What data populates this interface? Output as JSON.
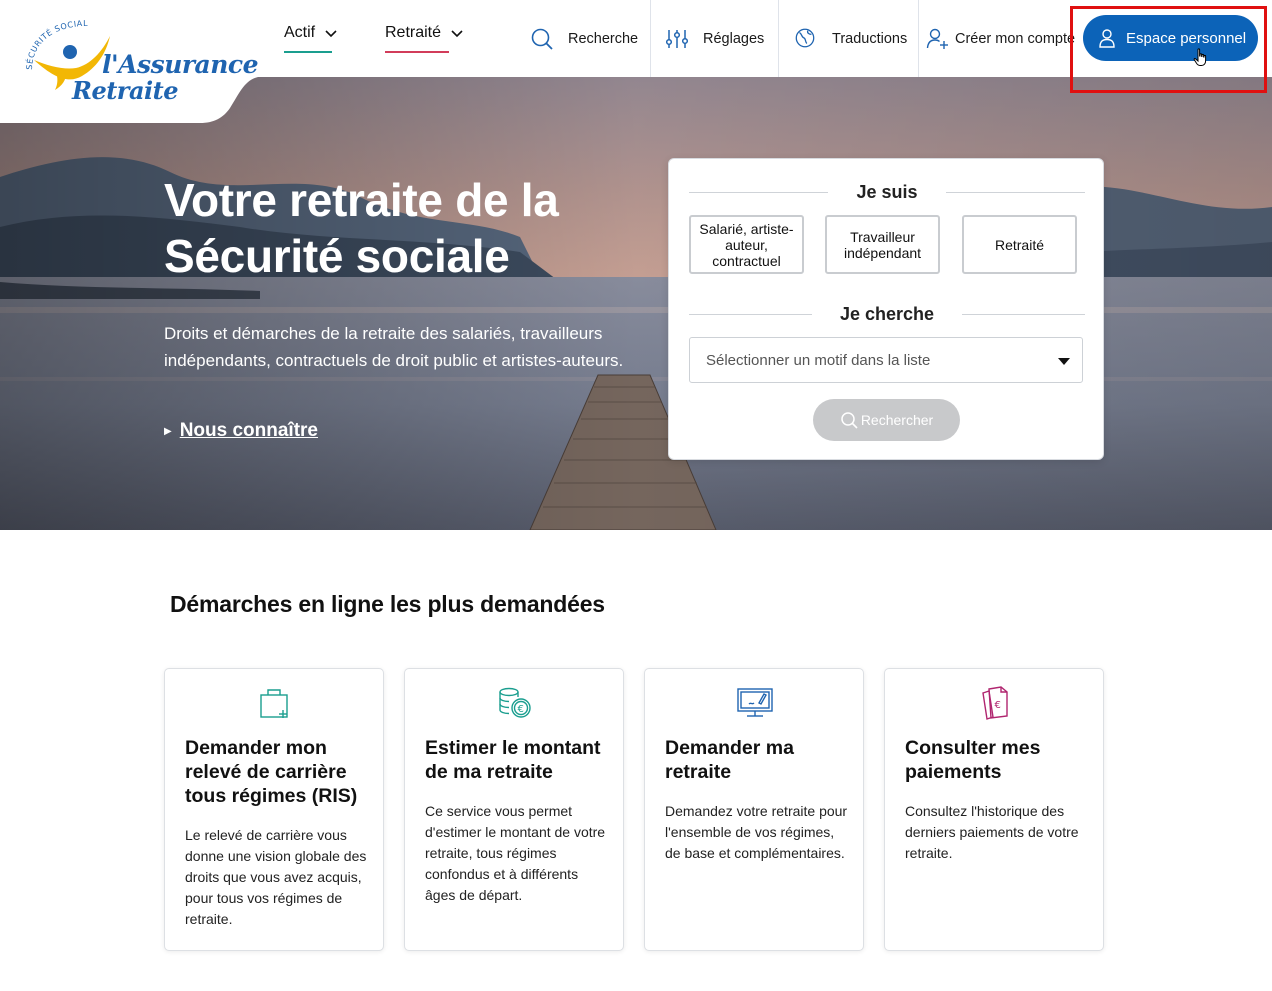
{
  "header": {
    "logo": {
      "arc_text": "SÉCURITÉ SOCIALE",
      "line1": "l'Assurance",
      "line2": "Retraite"
    },
    "nav": [
      {
        "label": "Actif",
        "underline_color": "#1a9e8f"
      },
      {
        "label": "Retraité",
        "underline_color": "#d23c5a"
      }
    ],
    "tools": {
      "search": "Recherche",
      "settings": "Réglages",
      "translations": "Traductions",
      "create_account": "Créer mon compte"
    },
    "espace_button": "Espace personnel"
  },
  "hero": {
    "title": "Votre retraite de la Sécurité sociale",
    "subtitle": "Droits et démarches de la retraite des salariés, travailleurs indépendants, contractuels de droit public et artistes-auteurs.",
    "link": "Nous connaître"
  },
  "panel": {
    "je_suis": "Je suis",
    "profiles": [
      "Salarié, artiste-auteur, contractuel",
      "Travailleur indépendant",
      "Retraité"
    ],
    "je_cherche": "Je cherche",
    "select_placeholder": "Sélectionner un motif dans la liste",
    "search_button": "Rechercher"
  },
  "services": {
    "title": "Démarches en ligne les plus demandées",
    "cards": [
      {
        "title": "Demander mon relevé de carrière tous régimes (RIS)",
        "desc": "Le relevé de carrière vous donne une vision globale des droits que vous avez acquis, pour tous vos régimes de retraite.",
        "icon": "bag-plus-icon"
      },
      {
        "title": "Estimer le montant de ma retraite",
        "desc": "Ce service vous permet d'estimer le montant de votre retraite, tous régimes confondus et à différents âges de départ.",
        "icon": "coins-euro-icon"
      },
      {
        "title": "Demander ma retraite",
        "desc": "Demandez votre retraite pour l'ensemble de vos régimes, de base et complémentaires.",
        "icon": "monitor-pen-icon"
      },
      {
        "title": "Consulter mes paiements",
        "desc": "Consultez l'historique des derniers paiements de votre retraite.",
        "icon": "documents-euro-icon"
      }
    ]
  },
  "colors": {
    "primary_blue": "#0c63b8",
    "teal": "#1a9e8f",
    "pink": "#d23c5a",
    "blue_icon": "#1f64b0",
    "magenta_icon": "#b0256f",
    "highlight_red": "#e01010"
  }
}
